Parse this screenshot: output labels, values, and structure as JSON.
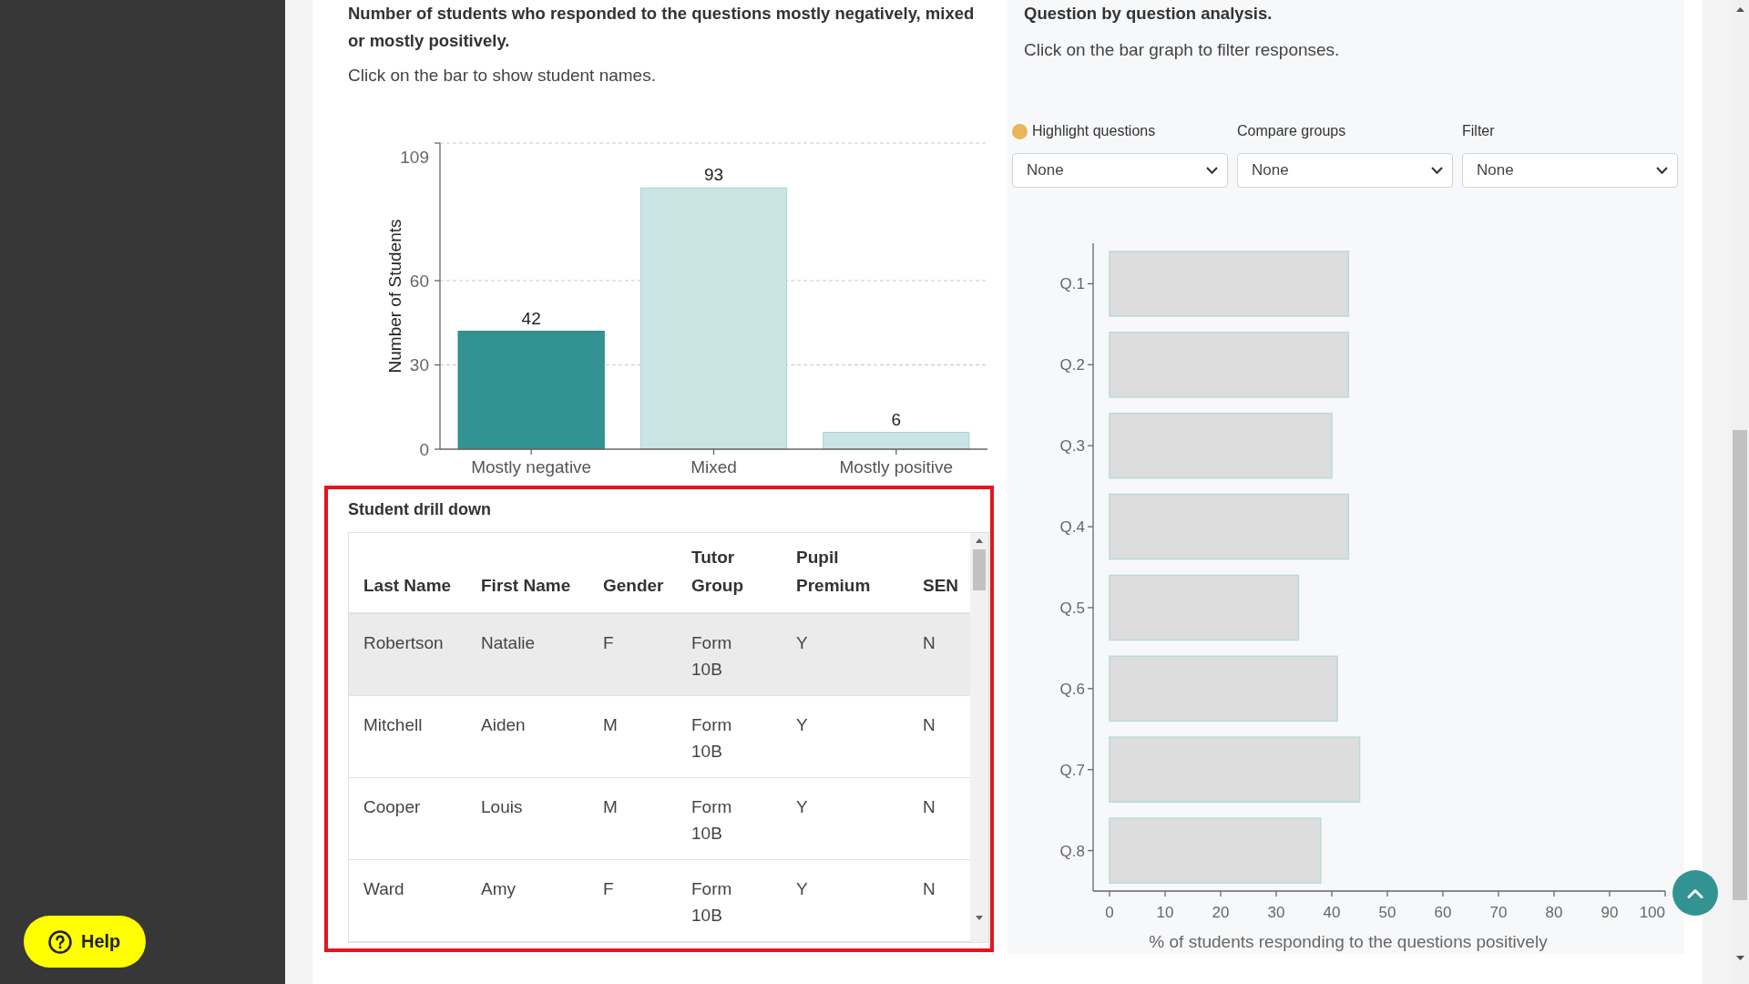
{
  "response_summary": {
    "heading": "Number of students who responded to the questions mostly negatively, mixed or mostly positively.",
    "instruction": "Click on the bar to show student names.",
    "chart_data": {
      "type": "bar",
      "ylabel": "Number of Students",
      "categories": [
        "Mostly negative",
        "Mixed",
        "Mostly positive"
      ],
      "values": [
        42,
        93,
        6
      ],
      "ylim": [
        0,
        109
      ],
      "yticks": [
        0,
        30,
        60,
        109
      ],
      "data_labels": true
    },
    "bars": [
      {
        "selected": true
      },
      {
        "selected": false
      },
      {
        "selected": false
      }
    ]
  },
  "drill_down": {
    "title": "Student drill down",
    "highlighted": true,
    "columns": [
      "Last Name",
      "First Name",
      "Gender",
      "Tutor Group",
      "Pupil Premium",
      "SEN"
    ],
    "rows": [
      {
        "cells": [
          "Robertson",
          "Natalie",
          "F",
          "Form 10B",
          "Y",
          "N"
        ],
        "highlighted": true
      },
      {
        "cells": [
          "Mitchell",
          "Aiden",
          "M",
          "Form 10B",
          "Y",
          "N"
        ],
        "highlighted": false
      },
      {
        "cells": [
          "Cooper",
          "Louis",
          "M",
          "Form 10B",
          "Y",
          "N"
        ],
        "highlighted": false
      },
      {
        "cells": [
          "Ward",
          "Amy",
          "F",
          "Form 10B",
          "Y",
          "N"
        ],
        "highlighted": false
      }
    ]
  },
  "question_analysis": {
    "heading": "Question by question analysis.",
    "instruction": "Click on the bar graph to filter responses.",
    "controls": [
      {
        "kind": "highlight",
        "label": "Highlight questions",
        "value": "None"
      },
      {
        "kind": "select",
        "label": "Compare groups",
        "value": "None"
      },
      {
        "kind": "select",
        "label": "Filter",
        "value": "None"
      }
    ],
    "chart_data": {
      "type": "bar",
      "orientation": "horizontal",
      "xlabel": "% of students responding to the questions positively",
      "categories": [
        "Q.1",
        "Q.2",
        "Q.3",
        "Q.4",
        "Q.5",
        "Q.6",
        "Q.7",
        "Q.8"
      ],
      "values": [
        43,
        43,
        40,
        43,
        34,
        41,
        45,
        38
      ],
      "xlim": [
        0,
        100
      ],
      "xticks": [
        0,
        10,
        20,
        30,
        40,
        50,
        60,
        70,
        80,
        90,
        100
      ]
    }
  },
  "help_button": {
    "label": "Help"
  }
}
